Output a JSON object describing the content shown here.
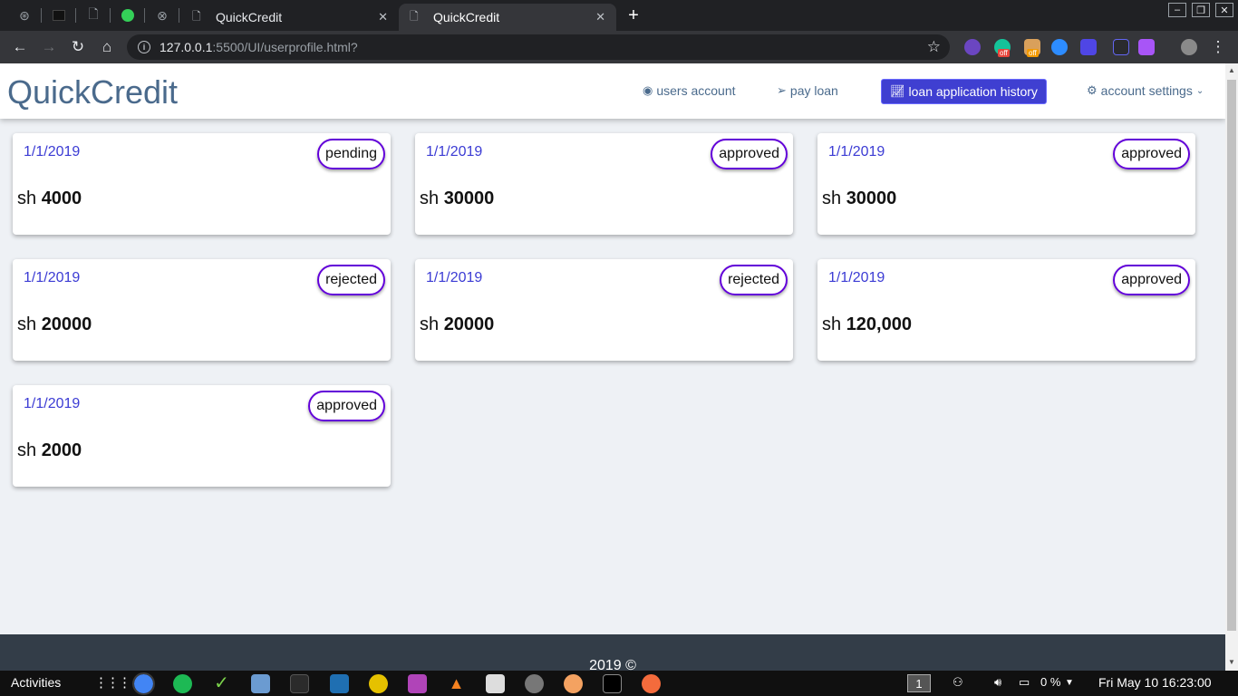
{
  "browser": {
    "tabs": [
      {
        "title": "QuickCredit",
        "icon": "page-icon"
      },
      {
        "title": "QuickCredit",
        "icon": "page-icon",
        "active": true
      }
    ],
    "url_host": "127.0.0.1",
    "url_rest": ":5500/UI/userprofile.html?"
  },
  "site": {
    "brand": "QuickCredit",
    "nav": {
      "users_account": "users account",
      "pay_loan": "pay loan",
      "loan_history": "loan application history",
      "account_settings": "account settings"
    },
    "loans": [
      {
        "date": "1/1/2019",
        "status": "pending",
        "currency": "sh",
        "amount": "4000"
      },
      {
        "date": "1/1/2019",
        "status": "approved",
        "currency": "sh",
        "amount": "30000"
      },
      {
        "date": "1/1/2019",
        "status": "approved",
        "currency": "sh",
        "amount": "30000"
      },
      {
        "date": "1/1/2019",
        "status": "rejected",
        "currency": "sh",
        "amount": "20000"
      },
      {
        "date": "1/1/2019",
        "status": "rejected",
        "currency": "sh",
        "amount": "20000"
      },
      {
        "date": "1/1/2019",
        "status": "approved",
        "currency": "sh",
        "amount": "120,000"
      },
      {
        "date": "1/1/2019",
        "status": "approved",
        "currency": "sh",
        "amount": "2000"
      }
    ],
    "footer": "2019 ©"
  },
  "taskbar": {
    "activities": "Activities",
    "workspace": "1",
    "battery": "0 %",
    "clock": "Fri May 10  16:23:00"
  },
  "colors": {
    "brand": "#4a6a8c",
    "active_nav": "#3f3fd1",
    "date": "#3b3bd4",
    "status_border": "#6200d9",
    "footer": "#333d48"
  }
}
